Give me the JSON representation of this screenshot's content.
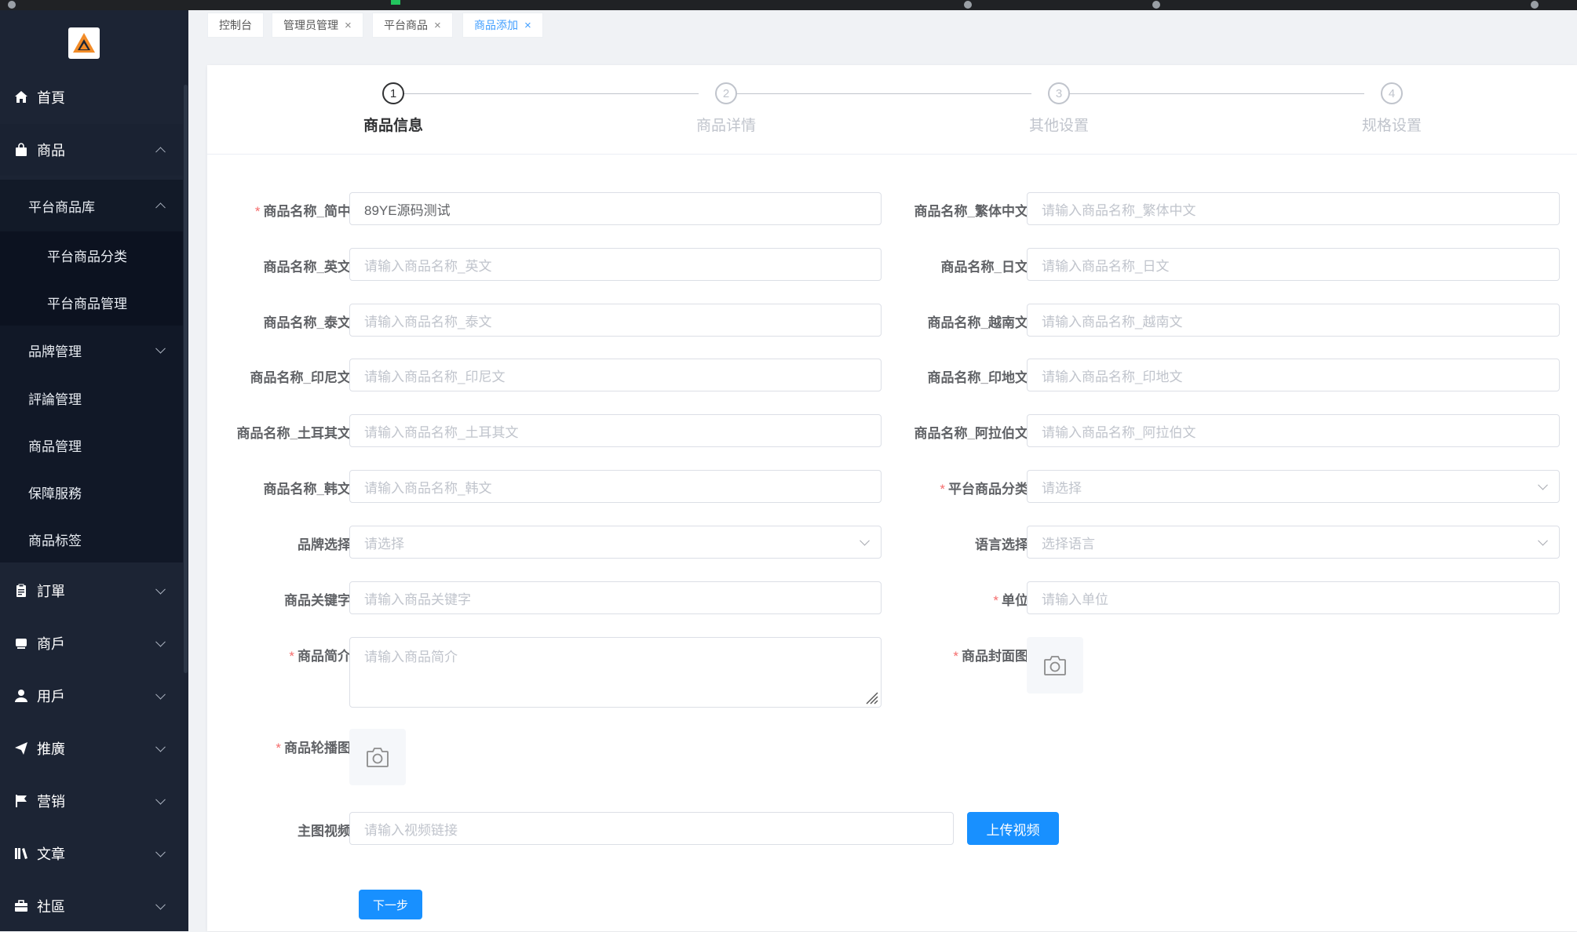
{
  "sidebar": {
    "items": [
      {
        "label": "首頁",
        "icon": "home-icon"
      },
      {
        "label": "商品",
        "icon": "bag-icon"
      },
      {
        "label": "訂單",
        "icon": "clipboard-icon"
      },
      {
        "label": "商戶",
        "icon": "shop-icon"
      },
      {
        "label": "用戶",
        "icon": "user-icon"
      },
      {
        "label": "推廣",
        "icon": "send-icon"
      },
      {
        "label": "营销",
        "icon": "flag-icon"
      },
      {
        "label": "文章",
        "icon": "book-icon"
      },
      {
        "label": "社區",
        "icon": "briefcase-icon"
      }
    ],
    "product_sub": {
      "library": "平台商品库",
      "library_children": [
        "平台商品分类",
        "平台商品管理"
      ],
      "brand": "品牌管理",
      "review": "評論管理",
      "goods": "商品管理",
      "service": "保障服務",
      "tags": "商品标签"
    }
  },
  "tabs": [
    {
      "label": "控制台",
      "closable": false
    },
    {
      "label": "管理员管理",
      "closable": true
    },
    {
      "label": "平台商品",
      "closable": true
    },
    {
      "label": "商品添加",
      "closable": true,
      "active": true
    }
  ],
  "tab_close_glyph": "×",
  "steps": [
    {
      "num": "1",
      "title": "商品信息",
      "active": true
    },
    {
      "num": "2",
      "title": "商品详情",
      "active": false
    },
    {
      "num": "3",
      "title": "其他设置",
      "active": false
    },
    {
      "num": "4",
      "title": "规格设置",
      "active": false
    }
  ],
  "form": {
    "required_mark": "*",
    "name_zh": {
      "label": "商品名称_简中",
      "value": "89YE源码测试"
    },
    "name_tw": {
      "label": "商品名称_繁体中文",
      "placeholder": "请输入商品名称_繁体中文"
    },
    "name_en": {
      "label": "商品名称_英文",
      "placeholder": "请输入商品名称_英文"
    },
    "name_ja": {
      "label": "商品名称_日文",
      "placeholder": "请输入商品名称_日文"
    },
    "name_th": {
      "label": "商品名称_泰文",
      "placeholder": "请输入商品名称_泰文"
    },
    "name_vi": {
      "label": "商品名称_越南文",
      "placeholder": "请输入商品名称_越南文"
    },
    "name_id": {
      "label": "商品名称_印尼文",
      "placeholder": "请输入商品名称_印尼文"
    },
    "name_hi": {
      "label": "商品名称_印地文",
      "placeholder": "请输入商品名称_印地文"
    },
    "name_tr": {
      "label": "商品名称_土耳其文",
      "placeholder": "请输入商品名称_土耳其文"
    },
    "name_ar": {
      "label": "商品名称_阿拉伯文",
      "placeholder": "请输入商品名称_阿拉伯文"
    },
    "name_ko": {
      "label": "商品名称_韩文",
      "placeholder": "请输入商品名称_韩文"
    },
    "category": {
      "label": "平台商品分类",
      "placeholder": "请选择"
    },
    "brand": {
      "label": "品牌选择",
      "placeholder": "请选择"
    },
    "language": {
      "label": "语言选择",
      "placeholder": "选择语言"
    },
    "keywords": {
      "label": "商品关键字",
      "placeholder": "请输入商品关键字"
    },
    "unit": {
      "label": "单位",
      "placeholder": "请输入单位"
    },
    "intro": {
      "label": "商品简介",
      "placeholder": "请输入商品简介"
    },
    "cover": {
      "label": "商品封面图"
    },
    "carousel": {
      "label": "商品轮播图"
    },
    "video": {
      "label": "主图视频",
      "placeholder": "请输入视频链接"
    },
    "upload_video": "上传视频",
    "next": "下一步"
  },
  "colors": {
    "sidebar_bg": "#1c2434",
    "primary": "#1890ff",
    "required": "#f56c6c"
  }
}
